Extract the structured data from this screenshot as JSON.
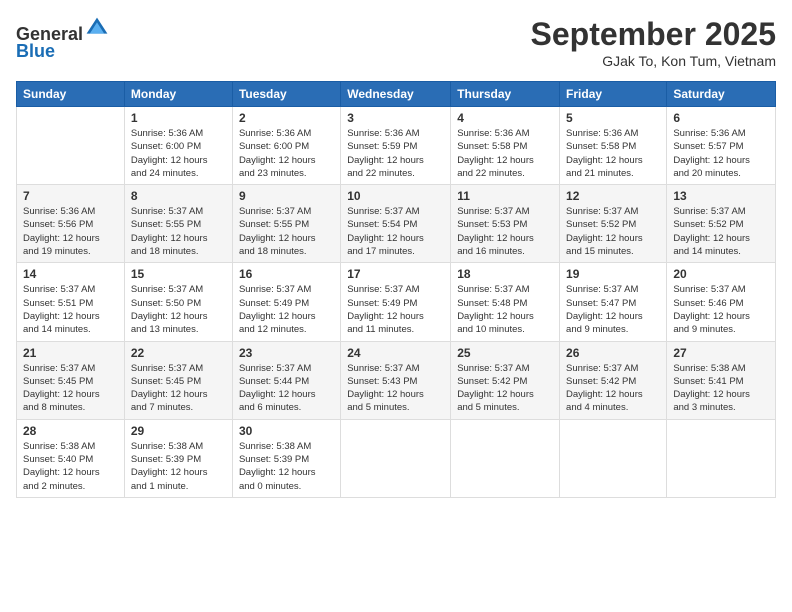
{
  "header": {
    "logo_line1": "General",
    "logo_line2": "Blue",
    "month": "September 2025",
    "location": "GJak To, Kon Tum, Vietnam"
  },
  "weekdays": [
    "Sunday",
    "Monday",
    "Tuesday",
    "Wednesday",
    "Thursday",
    "Friday",
    "Saturday"
  ],
  "weeks": [
    [
      {
        "day": "",
        "info": ""
      },
      {
        "day": "1",
        "info": "Sunrise: 5:36 AM\nSunset: 6:00 PM\nDaylight: 12 hours\nand 24 minutes."
      },
      {
        "day": "2",
        "info": "Sunrise: 5:36 AM\nSunset: 6:00 PM\nDaylight: 12 hours\nand 23 minutes."
      },
      {
        "day": "3",
        "info": "Sunrise: 5:36 AM\nSunset: 5:59 PM\nDaylight: 12 hours\nand 22 minutes."
      },
      {
        "day": "4",
        "info": "Sunrise: 5:36 AM\nSunset: 5:58 PM\nDaylight: 12 hours\nand 22 minutes."
      },
      {
        "day": "5",
        "info": "Sunrise: 5:36 AM\nSunset: 5:58 PM\nDaylight: 12 hours\nand 21 minutes."
      },
      {
        "day": "6",
        "info": "Sunrise: 5:36 AM\nSunset: 5:57 PM\nDaylight: 12 hours\nand 20 minutes."
      }
    ],
    [
      {
        "day": "7",
        "info": "Sunrise: 5:36 AM\nSunset: 5:56 PM\nDaylight: 12 hours\nand 19 minutes."
      },
      {
        "day": "8",
        "info": "Sunrise: 5:37 AM\nSunset: 5:55 PM\nDaylight: 12 hours\nand 18 minutes."
      },
      {
        "day": "9",
        "info": "Sunrise: 5:37 AM\nSunset: 5:55 PM\nDaylight: 12 hours\nand 18 minutes."
      },
      {
        "day": "10",
        "info": "Sunrise: 5:37 AM\nSunset: 5:54 PM\nDaylight: 12 hours\nand 17 minutes."
      },
      {
        "day": "11",
        "info": "Sunrise: 5:37 AM\nSunset: 5:53 PM\nDaylight: 12 hours\nand 16 minutes."
      },
      {
        "day": "12",
        "info": "Sunrise: 5:37 AM\nSunset: 5:52 PM\nDaylight: 12 hours\nand 15 minutes."
      },
      {
        "day": "13",
        "info": "Sunrise: 5:37 AM\nSunset: 5:52 PM\nDaylight: 12 hours\nand 14 minutes."
      }
    ],
    [
      {
        "day": "14",
        "info": "Sunrise: 5:37 AM\nSunset: 5:51 PM\nDaylight: 12 hours\nand 14 minutes."
      },
      {
        "day": "15",
        "info": "Sunrise: 5:37 AM\nSunset: 5:50 PM\nDaylight: 12 hours\nand 13 minutes."
      },
      {
        "day": "16",
        "info": "Sunrise: 5:37 AM\nSunset: 5:49 PM\nDaylight: 12 hours\nand 12 minutes."
      },
      {
        "day": "17",
        "info": "Sunrise: 5:37 AM\nSunset: 5:49 PM\nDaylight: 12 hours\nand 11 minutes."
      },
      {
        "day": "18",
        "info": "Sunrise: 5:37 AM\nSunset: 5:48 PM\nDaylight: 12 hours\nand 10 minutes."
      },
      {
        "day": "19",
        "info": "Sunrise: 5:37 AM\nSunset: 5:47 PM\nDaylight: 12 hours\nand 9 minutes."
      },
      {
        "day": "20",
        "info": "Sunrise: 5:37 AM\nSunset: 5:46 PM\nDaylight: 12 hours\nand 9 minutes."
      }
    ],
    [
      {
        "day": "21",
        "info": "Sunrise: 5:37 AM\nSunset: 5:45 PM\nDaylight: 12 hours\nand 8 minutes."
      },
      {
        "day": "22",
        "info": "Sunrise: 5:37 AM\nSunset: 5:45 PM\nDaylight: 12 hours\nand 7 minutes."
      },
      {
        "day": "23",
        "info": "Sunrise: 5:37 AM\nSunset: 5:44 PM\nDaylight: 12 hours\nand 6 minutes."
      },
      {
        "day": "24",
        "info": "Sunrise: 5:37 AM\nSunset: 5:43 PM\nDaylight: 12 hours\nand 5 minutes."
      },
      {
        "day": "25",
        "info": "Sunrise: 5:37 AM\nSunset: 5:42 PM\nDaylight: 12 hours\nand 5 minutes."
      },
      {
        "day": "26",
        "info": "Sunrise: 5:37 AM\nSunset: 5:42 PM\nDaylight: 12 hours\nand 4 minutes."
      },
      {
        "day": "27",
        "info": "Sunrise: 5:38 AM\nSunset: 5:41 PM\nDaylight: 12 hours\nand 3 minutes."
      }
    ],
    [
      {
        "day": "28",
        "info": "Sunrise: 5:38 AM\nSunset: 5:40 PM\nDaylight: 12 hours\nand 2 minutes."
      },
      {
        "day": "29",
        "info": "Sunrise: 5:38 AM\nSunset: 5:39 PM\nDaylight: 12 hours\nand 1 minute."
      },
      {
        "day": "30",
        "info": "Sunrise: 5:38 AM\nSunset: 5:39 PM\nDaylight: 12 hours\nand 0 minutes."
      },
      {
        "day": "",
        "info": ""
      },
      {
        "day": "",
        "info": ""
      },
      {
        "day": "",
        "info": ""
      },
      {
        "day": "",
        "info": ""
      }
    ]
  ]
}
